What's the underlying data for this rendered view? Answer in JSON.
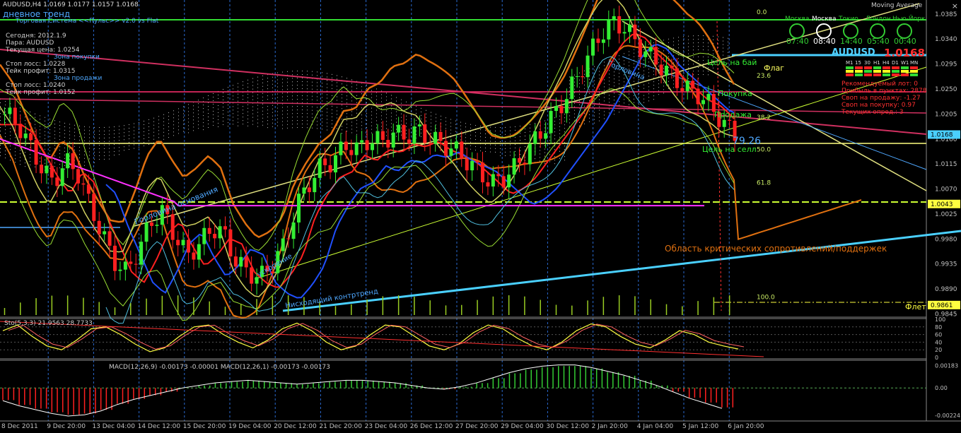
{
  "header": {
    "symbol_line": "AUDUSD,H4  1.0169 1.0177 1.0157 1.0168",
    "trend_label": "дневное тренд",
    "subtitle": "Торговая Система <<Пульс>> v2.0 vs Flat",
    "indicator_title": "Moving Average",
    "close_glyph": "×"
  },
  "info_panel": {
    "lines": [
      {
        "text": "Сегодня: 2012.1.9",
        "color": "#d0d0d0"
      },
      {
        "text": "Пара: AUDUSD",
        "color": "#d0d0d0"
      },
      {
        "text": "Текущая цена: 1.0254",
        "color": "#d0d0d0"
      },
      {
        "text": "Зона покупки",
        "color": "#4fa8ff"
      },
      {
        "text": "Стоп лосс: 1.0228",
        "color": "#d0d0d0"
      },
      {
        "text": "Тейк профит: 1.0315",
        "color": "#d0d0d0"
      },
      {
        "text": "Зона продажи",
        "color": "#4fa8ff"
      },
      {
        "text": "Стоп лосс: 1.0240",
        "color": "#d0d0d0"
      },
      {
        "text": "Тейк профит: 1.0152",
        "color": "#d0d0d0"
      }
    ]
  },
  "clocks": {
    "names": [
      "Москва",
      "Москва",
      "Токио",
      "Лондон",
      "Нью-Йорк"
    ],
    "times": [
      "07:40",
      "08:40",
      "14:40",
      "05:40",
      "00:40"
    ]
  },
  "ticker": {
    "symbol": "AUDUSD",
    "price": "1.0168",
    "timeframes": [
      "M1",
      "15",
      "30",
      "H1",
      "H4",
      "D1",
      "W1",
      "MN"
    ],
    "stats": [
      "Рекомендуемый лот: 0",
      "Прибыль в пунктах: 2878",
      "Своп на продажу: -1.27",
      "Своп на покупку: 0.97",
      "Текущих опред.: 3"
    ]
  },
  "annotations": {
    "flag": "Флаг",
    "target_buy": "Цель на бай",
    "target_sell": "Цель на селл",
    "buy": "Покупка",
    "sell": "Продажа",
    "neck_top": "Горловина",
    "neck_base": "Горловина основания",
    "acceleration": "ускорение",
    "counter_trend": "Нисходящий контртренд",
    "critical_zone": "Область критических сопротивлений/поддержек",
    "flat": "Флет",
    "big_number": "79.26"
  },
  "fibo": {
    "levels": [
      "0.0",
      "23.6",
      "38.2",
      "50.0",
      "61.8",
      "100.0"
    ],
    "prices": [
      1.0382,
      1.0268,
      1.0193,
      1.0135,
      1.0075,
      0.9869
    ]
  },
  "chart_data": [
    {
      "type": "candlestick",
      "symbol": "AUDUSD",
      "timeframe": "H4",
      "ohlc_last": {
        "open": 1.0169,
        "high": 1.0177,
        "low": 1.0157,
        "close": 1.0168
      },
      "ylim": [
        0.9843,
        1.0395
      ],
      "y_ticks": [
        "1.0385",
        "1.0340",
        "1.0295",
        "1.0250",
        "1.0205",
        "1.0160",
        "1.0115",
        "1.0070",
        "1.0025",
        "0.9980",
        "0.9935",
        "0.9890",
        "0.9845"
      ],
      "price_labels": [
        {
          "value": 1.0168,
          "label": "1.0168"
        },
        {
          "value": 1.0043,
          "label": "1.0043"
        },
        {
          "value": 0.9861,
          "label": "0.9861"
        }
      ],
      "x_labels": [
        "8 Dec 2011",
        "9 Dec 20:00",
        "13 Dec 04:00",
        "14 Dec 12:00",
        "15 Dec 20:00",
        "19 Dec 04:00",
        "20 Dec 12:00",
        "21 Dec 20:00",
        "23 Dec 04:00",
        "26 Dec 12:00",
        "27 Dec 20:00",
        "29 Dec 04:00",
        "30 Dec 12:00",
        "2 Jan 20:00",
        "4 Jan 04:00",
        "5 Jan 12:00",
        "6 Jan 20:00"
      ],
      "close_path": [
        1.0205,
        1.019,
        1.015,
        1.011,
        1.008,
        1.012,
        1.01,
        1.004,
        0.999,
        0.994,
        0.992,
        0.996,
        1.001,
        1.003,
        0.9985,
        0.995,
        0.997,
        1.0,
        0.999,
        0.994,
        0.992,
        0.991,
        0.9935,
        0.997,
        1.004,
        1.008,
        1.011,
        1.012,
        1.015,
        1.014,
        1.016,
        1.0155,
        1.017,
        1.0165,
        1.0175,
        1.016,
        1.015,
        1.014,
        1.012,
        1.01,
        1.008,
        1.009,
        1.011,
        1.014,
        1.017,
        1.02,
        1.023,
        1.027,
        1.031,
        1.035,
        1.037,
        1.036,
        1.033,
        1.031,
        1.029,
        1.027,
        1.025,
        1.024,
        1.022,
        1.019,
        1.0168
      ]
    },
    {
      "type": "line",
      "name": "Sto(5,3,3) 21.9563 28.7733",
      "ylim": [
        0,
        100
      ],
      "y_ticks": [
        "100",
        "80",
        "60",
        "40",
        "20",
        "0"
      ],
      "values": [
        70,
        85,
        55,
        30,
        20,
        45,
        75,
        80,
        60,
        35,
        15,
        25,
        55,
        80,
        85,
        60,
        40,
        25,
        45,
        75,
        90,
        70,
        40,
        20,
        30,
        60,
        85,
        80,
        55,
        30,
        20,
        35,
        65,
        85,
        75,
        50,
        30,
        20,
        40,
        70,
        88,
        80,
        55,
        35,
        25,
        45,
        70,
        60,
        40,
        30,
        22
      ]
    },
    {
      "type": "bar",
      "name": "MACD(12,26,9) -0.00173 -0.00001 MACD(12,26,1) -0.00173 -0.00173",
      "ylim": [
        -0.0026,
        0.0021
      ],
      "y_ticks": [
        "0.00183",
        "0.00",
        "-0.00224"
      ],
      "values": [
        -0.001,
        -0.0014,
        -0.0017,
        -0.002,
        -0.0022,
        -0.0021,
        -0.0018,
        -0.0013,
        -0.0009,
        -0.0006,
        -0.0003,
        0.0,
        0.0002,
        0.0004,
        0.0005,
        0.0006,
        0.0005,
        0.0004,
        0.0003,
        0.0004,
        0.0005,
        0.0006,
        0.0006,
        0.0005,
        0.0004,
        0.0002,
        0.0,
        -0.0001,
        0.0001,
        0.0004,
        0.0008,
        0.0012,
        0.0015,
        0.0017,
        0.0018,
        0.0018,
        0.0016,
        0.0013,
        0.001,
        0.0006,
        0.0002,
        -0.0003,
        -0.0008,
        -0.0012,
        -0.0016
      ]
    }
  ]
}
